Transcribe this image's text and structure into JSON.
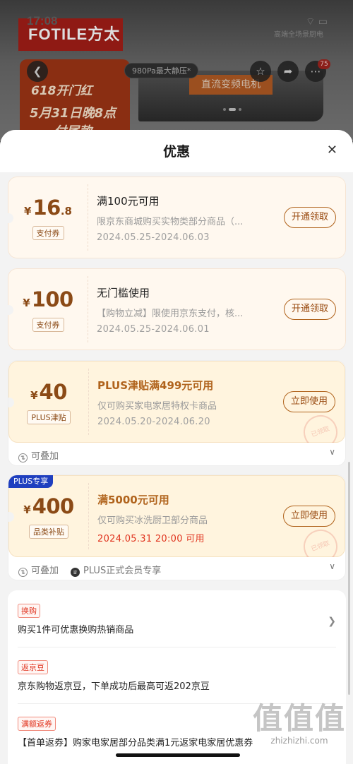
{
  "backdrop": {
    "time": "17:08",
    "brand": "FOTILE方太",
    "status_icons": "⌔ ▭",
    "recent_label": "高端全场景厨电",
    "spec_pill": "980Pa最大静压*",
    "feature_label": "直流变频电机",
    "promo_line1": "618开门红",
    "promo_line2": "5月31日晚8点",
    "promo_line3": "付尾款",
    "cart_badge": "75"
  },
  "sheet": {
    "title": "优惠",
    "close_icon": "✕"
  },
  "coupons": [
    {
      "currency": "¥",
      "amount": "16",
      "decimal": ".8",
      "type_tag": "支付券",
      "title": "满100元可用",
      "desc": "限京东商城购买实物类部分商品（...",
      "date": "2024.05.25-2024.06.03",
      "button": "开通领取"
    },
    {
      "currency": "¥",
      "amount": "100",
      "decimal": "",
      "type_tag": "支付券",
      "title": "无门槛使用",
      "desc": "【购物立减】限使用京东支付，核...",
      "date": "2024.05.25-2024.06.01",
      "button": "开通领取"
    },
    {
      "currency": "¥",
      "amount": "40",
      "decimal": "",
      "type_tag": "PLUS津贴",
      "title": "PLUS津贴满499元可用",
      "desc": "仅可购买家电家居特权卡商品",
      "date": "2024.05.20-2024.06.20",
      "button": "立即使用",
      "stamp": "已领取",
      "stack_label": "可叠加"
    },
    {
      "corner_tag": "PLUS专享",
      "currency": "¥",
      "amount": "400",
      "decimal": "",
      "type_tag": "品类补贴",
      "title": "满5000元可用",
      "desc": "仅可购买冰洗厨卫部分商品",
      "date": "2024.05.31 20:00 可用",
      "button": "立即使用",
      "stamp": "已领取",
      "stack_label": "可叠加",
      "member_label": "PLUS正式会员专享"
    }
  ],
  "promotions": [
    {
      "tag": "换购",
      "text": "购买1件可优惠换购热销商品"
    },
    {
      "tag": "返京豆",
      "text": "京东购物返京豆，下单成功后最高可返202京豆"
    },
    {
      "tag": "满额返券",
      "text": "【首单返券】购家电家居部分品类满1元返家电家居优惠券"
    }
  ],
  "watermark": {
    "logo": "值值值",
    "url": "zhizhizhi.com"
  }
}
